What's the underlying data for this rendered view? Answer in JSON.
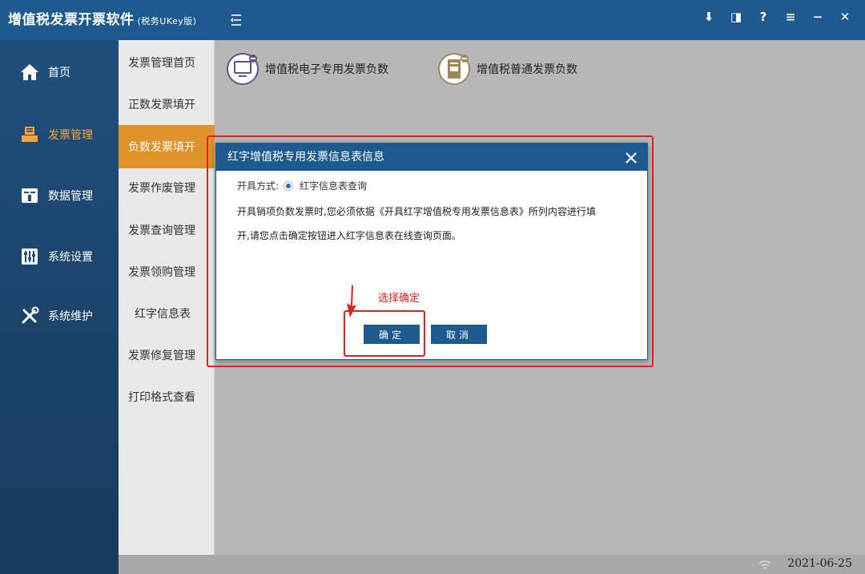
{
  "titlebar": {
    "app_name": "增值税发票开票软件",
    "app_edition": "(税务UKey版)",
    "window_controls": [
      {
        "name": "pin",
        "glyph": "⬇"
      },
      {
        "name": "restore",
        "glyph": "◨"
      },
      {
        "name": "help",
        "glyph": "?"
      },
      {
        "name": "menu",
        "glyph": "≡"
      },
      {
        "name": "minimize",
        "glyph": "−"
      },
      {
        "name": "close",
        "glyph": "✕"
      }
    ]
  },
  "leftnav": {
    "items": [
      {
        "label": "首页",
        "icon": "home-icon"
      },
      {
        "label": "发票管理",
        "icon": "printer-icon",
        "active": true
      },
      {
        "label": "数据管理",
        "icon": "database-icon"
      },
      {
        "label": "系统设置",
        "icon": "sliders-icon"
      },
      {
        "label": "系统维护",
        "icon": "wrench-icon"
      }
    ]
  },
  "subnav": {
    "items": [
      {
        "label": "发票管理首页"
      },
      {
        "label": "正数发票填开"
      },
      {
        "label": "负数发票填开",
        "active": true
      },
      {
        "label": "发票作废管理"
      },
      {
        "label": "发票查询管理"
      },
      {
        "label": "发票领购管理"
      },
      {
        "label": "红字信息表"
      },
      {
        "label": "发票修复管理"
      },
      {
        "label": "打印格式查看"
      }
    ]
  },
  "content": {
    "shortcuts": [
      {
        "label": "增值税电子专用发票负数",
        "icon": "computer-invoice-icon"
      },
      {
        "label": "增值税普通发票负数",
        "icon": "invoice-document-icon"
      }
    ]
  },
  "dialog": {
    "title": "红字增值税专用发票信息表信息",
    "method_label": "开具方式:",
    "method_option": "红字信息表查询",
    "message_line1": "开具销项负数发票时,您必须依据《开具红字增值税专用发票信息表》所列内容进行填",
    "message_line2": "开,请您点击确定按钮进入红字信息表在线查询页面。",
    "confirm_label": "确定",
    "cancel_label": "取消"
  },
  "annotation": {
    "text": "选择确定",
    "color": "#e3211c"
  },
  "statusbar": {
    "date": "2021-06-25"
  },
  "colors": {
    "primary": "#1d5a8f",
    "active_sub": "#e0932a",
    "active_nav_text": "#f5a53a"
  }
}
